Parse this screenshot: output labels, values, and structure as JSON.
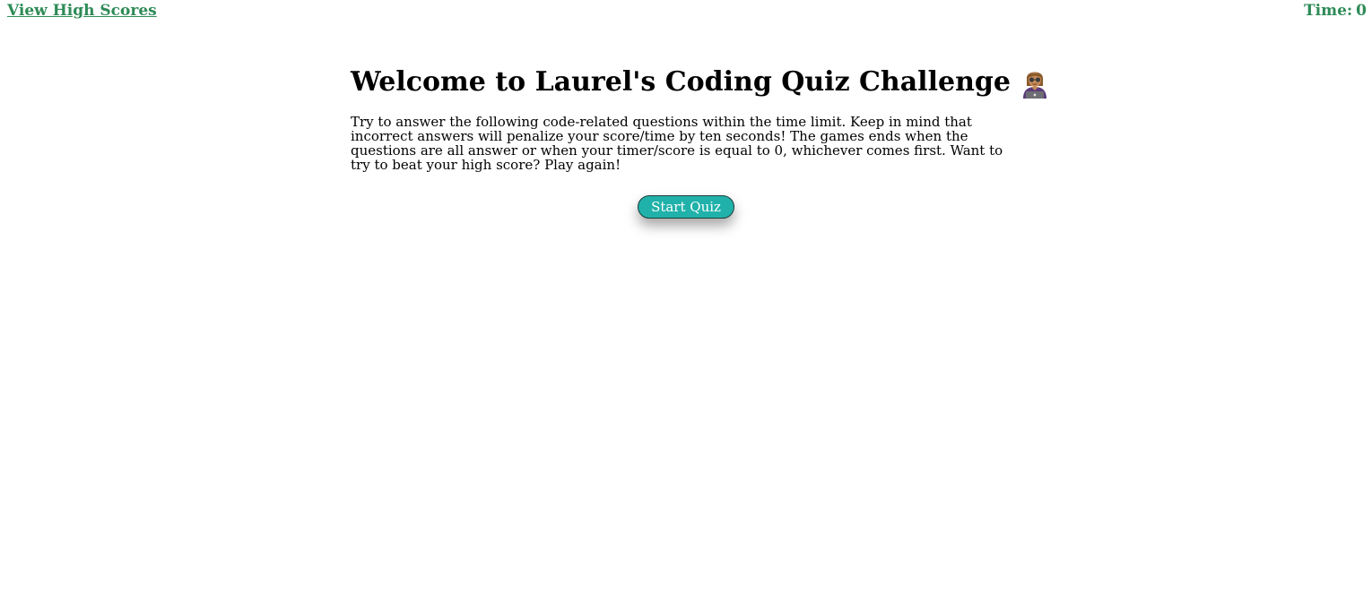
{
  "header": {
    "high_scores_link": "View High Scores",
    "timer_label": "Time:",
    "timer_value": "0"
  },
  "main": {
    "title": "Welcome to Laurel's Coding Quiz Challenge",
    "title_icon": "woman-technologist-icon",
    "intro": "Try to answer the following code-related questions within the time limit. Keep in mind that incorrect answers will penalize your score/time by ten seconds! The games ends when the questions are all answer or when your timer/score is equal to 0, whichever comes first. Want to try to beat your high score? Play again!",
    "start_button": "Start Quiz"
  },
  "colors": {
    "link": "#2e8b57",
    "button_bg": "#20b2aa",
    "button_text": "#ffffff",
    "background": "#ffffff"
  }
}
